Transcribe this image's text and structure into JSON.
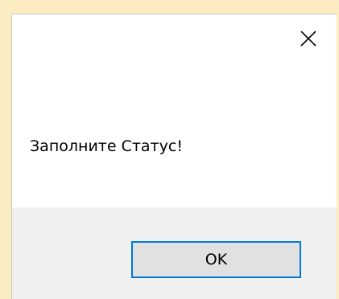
{
  "dialog": {
    "close_icon": "close-icon",
    "message": "Заполните Статус!",
    "ok_label": "OK"
  },
  "colors": {
    "page_background": "#fbecc2",
    "dialog_background": "#ffffff",
    "footer_background": "#f0f0f0",
    "button_background": "#e1e1e1",
    "button_focus_border": "#0078d7"
  }
}
